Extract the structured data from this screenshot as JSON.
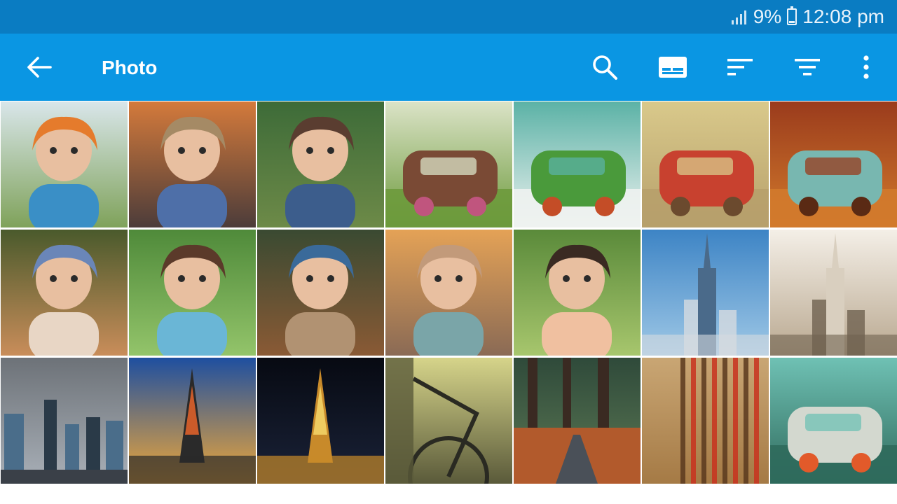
{
  "status_bar": {
    "battery_percent": "9%",
    "time": "12:08 pm"
  },
  "app_bar": {
    "title": "Photo",
    "actions": [
      "search-icon",
      "slideshow-icon",
      "sort-icon",
      "filter-icon",
      "more-vert-icon"
    ]
  },
  "photos": [
    {
      "palette": [
        "#d9e6ea",
        "#7fa25a",
        "#e57b2c",
        "#3a8fc6"
      ],
      "kind": "kids-hats"
    },
    {
      "palette": [
        "#d47a3b",
        "#4c3c3a",
        "#a58a65",
        "#4e6fa8"
      ],
      "kind": "girl-field"
    },
    {
      "palette": [
        "#3d6b38",
        "#6d8a48",
        "#5a3d30",
        "#3c5d8c"
      ],
      "kind": "child-portrait"
    },
    {
      "palette": [
        "#dbe3c7",
        "#6d9a3c",
        "#7a4a35",
        "#c0557e"
      ],
      "kind": "flower-cart"
    },
    {
      "palette": [
        "#5bb2a6",
        "#eef2f0",
        "#4a9a3b",
        "#c44d27"
      ],
      "kind": "red-truck"
    },
    {
      "palette": [
        "#d9c98b",
        "#b7a06b",
        "#c8412f",
        "#6b4a2e"
      ],
      "kind": "red-beetle"
    },
    {
      "palette": [
        "#9a3b1c",
        "#d27a2c",
        "#78b7b0",
        "#5a2a14"
      ],
      "kind": "vw-bus"
    },
    {
      "palette": [
        "#4a5a2c",
        "#c98d5a",
        "#6a86b8",
        "#e8d6c5"
      ],
      "kind": "girls-hug"
    },
    {
      "palette": [
        "#4f8a3a",
        "#93c46a",
        "#5b3a2a",
        "#6ab6d6"
      ],
      "kind": "girl-bangs"
    },
    {
      "palette": [
        "#3a4a32",
        "#8a5a35",
        "#3a6a9a",
        "#b19272"
      ],
      "kind": "baby-cap"
    },
    {
      "palette": [
        "#e4a256",
        "#8a6a55",
        "#c29a7a",
        "#7aa5a8"
      ],
      "kind": "toddler-road"
    },
    {
      "palette": [
        "#5a8a3a",
        "#a7c66d",
        "#3a2a22",
        "#f0c0a0"
      ],
      "kind": "baby-smile"
    },
    {
      "palette": [
        "#3d84c5",
        "#9fc8e6",
        "#d6dbe0",
        "#4a6a8a"
      ],
      "kind": "empire-state"
    },
    {
      "palette": [
        "#f4efe7",
        "#b9a890",
        "#6f6250",
        "#d9cfbf"
      ],
      "kind": "chrysler"
    },
    {
      "palette": [
        "#6d7278",
        "#a9b0b8",
        "#4a6d8a",
        "#2a3a48"
      ],
      "kind": "city-skyline"
    },
    {
      "palette": [
        "#1e4fa0",
        "#f0a838",
        "#e8642a",
        "#2a2a2a"
      ],
      "kind": "eiffel-sunset"
    },
    {
      "palette": [
        "#070a12",
        "#1a2238",
        "#f4d66a",
        "#c88a2a"
      ],
      "kind": "eiffel-night"
    },
    {
      "palette": [
        "#d6d48a",
        "#5a5a3a",
        "#2a2a22",
        "#b8b57a"
      ],
      "kind": "bicycle"
    },
    {
      "palette": [
        "#2f4a3a",
        "#5d7a55",
        "#b25a2c",
        "#3a2a22"
      ],
      "kind": "forest-path"
    },
    {
      "palette": [
        "#c9a674",
        "#a57a45",
        "#c8331f",
        "#5a3a1f"
      ],
      "kind": "bamboo"
    },
    {
      "palette": [
        "#6fc1b4",
        "#2f6a5c",
        "#d3d8cf",
        "#e25a2a"
      ],
      "kind": "teal-bus"
    }
  ]
}
